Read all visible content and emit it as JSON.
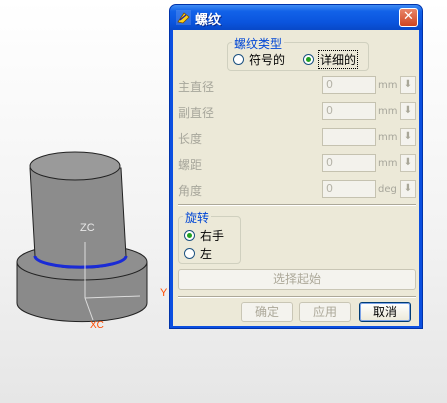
{
  "viewport": {
    "axis_label_zc": "ZC",
    "axis_label_y": "Y",
    "axis_label_xc": "XC",
    "axis_color": "#ff4c00",
    "edge_highlight_color": "#1a2bd6"
  },
  "dialog": {
    "title": "螺纹",
    "close_glyph": "✕",
    "thread_type": {
      "legend": "螺纹类型",
      "options": [
        {
          "label": "符号的",
          "checked": false
        },
        {
          "label": "详细的",
          "checked": true
        }
      ]
    },
    "params": [
      {
        "label": "主直径",
        "value": "0",
        "unit": "mm"
      },
      {
        "label": "副直径",
        "value": "0",
        "unit": "mm"
      },
      {
        "label": "长度",
        "value": "",
        "unit": "mm"
      },
      {
        "label": "螺距",
        "value": "0",
        "unit": "mm"
      },
      {
        "label": "角度",
        "value": "0",
        "unit": "deg"
      }
    ],
    "rotation": {
      "legend": "旋转",
      "options": [
        {
          "label": "右手",
          "checked": true
        },
        {
          "label": "左",
          "checked": false
        }
      ]
    },
    "select_start_label": "选择起始",
    "buttons": {
      "ok": "确定",
      "apply": "应用",
      "cancel": "取消"
    }
  }
}
